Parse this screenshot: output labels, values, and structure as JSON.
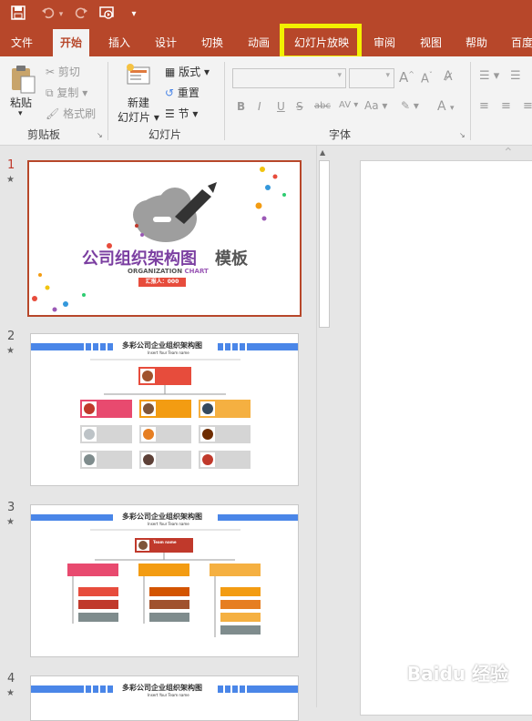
{
  "quick_access": {
    "save_icon": "save-icon",
    "undo_icon": "undo-icon",
    "redo_icon": "redo-icon",
    "present_icon": "present-from-start-icon",
    "customize_icon": "customize-qat-icon"
  },
  "tabs": [
    "文件",
    "开始",
    "插入",
    "设计",
    "切换",
    "动画",
    "幻灯片放映",
    "审阅",
    "视图",
    "帮助",
    "百度"
  ],
  "active_tab": "开始",
  "highlighted_tab": "幻灯片放映",
  "ribbon": {
    "clipboard": {
      "paste": "粘贴",
      "cut": "剪切",
      "copy": "复制",
      "format_painter": "格式刷",
      "label": "剪贴板"
    },
    "slides": {
      "new_slide_line1": "新建",
      "new_slide_line2": "幻灯片",
      "layout": "版式",
      "reset": "重置",
      "section": "节",
      "label": "幻灯片"
    },
    "font": {
      "label": "字体",
      "bold": "B",
      "italic": "I",
      "underline": "U",
      "strike": "S",
      "strike2": "abc",
      "spacing": "AV",
      "case": "Aa",
      "color": "A",
      "grow": "A",
      "shrink": "A"
    }
  },
  "slides": [
    {
      "number": "1",
      "title_main": "公司组织架构图",
      "title_bold": "模板",
      "subtitle_en": "ORGANIZATION",
      "subtitle_en2": "CHART",
      "reporter": "汇报人：000"
    },
    {
      "number": "2",
      "title": "多彩公司企业组织架构图",
      "subtitle": "Insert Your Team name"
    },
    {
      "number": "3",
      "title": "多彩公司企业组织架构图",
      "subtitle": "Insert Your Team name",
      "head": "Team name"
    },
    {
      "number": "4",
      "title": "多彩公司企业组织架构图",
      "subtitle": "Insert Your Team name"
    }
  ],
  "star": "★",
  "colors": {
    "brand": "#b7472a",
    "highlight": "#f3f100",
    "blue": "#4a86e8",
    "red": "#e74c3c",
    "orange": "#f39c12",
    "purple": "#8e44ad"
  },
  "watermark": "Baidu 经验"
}
